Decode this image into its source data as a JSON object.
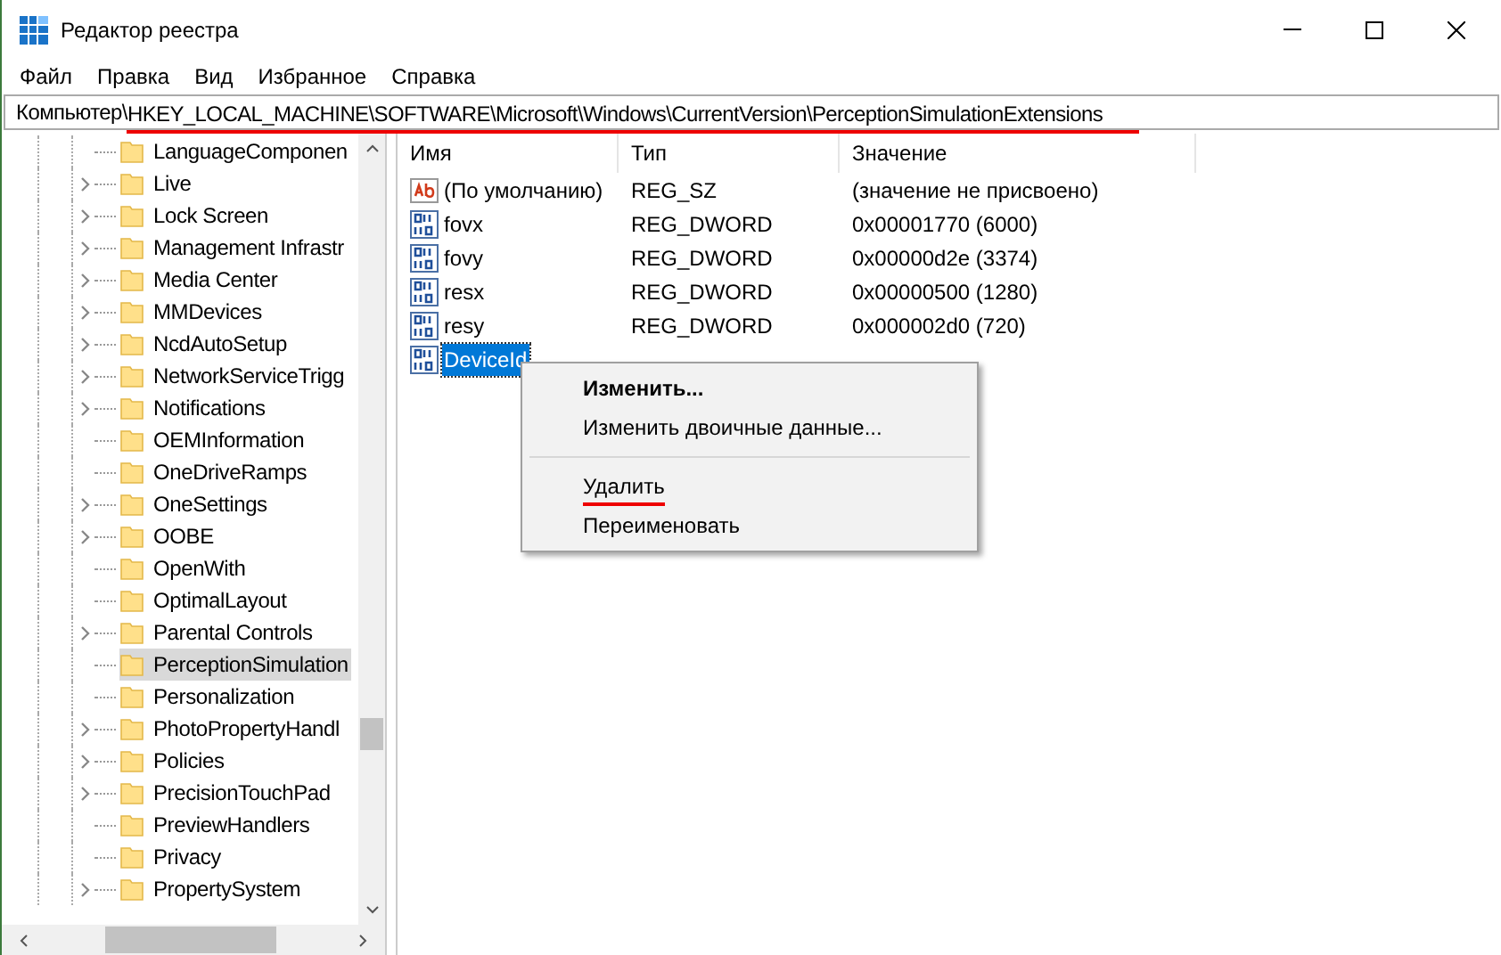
{
  "window": {
    "title": "Редактор реестра"
  },
  "menu_bar": [
    "Файл",
    "Правка",
    "Вид",
    "Избранное",
    "Справка"
  ],
  "address_bar": {
    "root": "Компьютер\\",
    "path": "HKEY_LOCAL_MACHINE\\SOFTWARE\\Microsoft\\Windows\\CurrentVersion\\PerceptionSimulationExtensions",
    "path_underlined": true
  },
  "tree": {
    "items": [
      {
        "label": "LanguageComponen",
        "expandable": false,
        "selected": false
      },
      {
        "label": "Live",
        "expandable": true,
        "selected": false
      },
      {
        "label": "Lock Screen",
        "expandable": true,
        "selected": false
      },
      {
        "label": "Management Infrastr",
        "expandable": true,
        "selected": false
      },
      {
        "label": "Media Center",
        "expandable": true,
        "selected": false
      },
      {
        "label": "MMDevices",
        "expandable": true,
        "selected": false
      },
      {
        "label": "NcdAutoSetup",
        "expandable": true,
        "selected": false
      },
      {
        "label": "NetworkServiceTrigg",
        "expandable": true,
        "selected": false
      },
      {
        "label": "Notifications",
        "expandable": true,
        "selected": false
      },
      {
        "label": "OEMInformation",
        "expandable": false,
        "selected": false
      },
      {
        "label": "OneDriveRamps",
        "expandable": false,
        "selected": false
      },
      {
        "label": "OneSettings",
        "expandable": true,
        "selected": false
      },
      {
        "label": "OOBE",
        "expandable": true,
        "selected": false
      },
      {
        "label": "OpenWith",
        "expandable": false,
        "selected": false
      },
      {
        "label": "OptimalLayout",
        "expandable": false,
        "selected": false
      },
      {
        "label": "Parental Controls",
        "expandable": true,
        "selected": false
      },
      {
        "label": "PerceptionSimulation",
        "expandable": false,
        "selected": true
      },
      {
        "label": "Personalization",
        "expandable": false,
        "selected": false
      },
      {
        "label": "PhotoPropertyHandl",
        "expandable": true,
        "selected": false
      },
      {
        "label": "Policies",
        "expandable": true,
        "selected": false
      },
      {
        "label": "PrecisionTouchPad",
        "expandable": true,
        "selected": false
      },
      {
        "label": "PreviewHandlers",
        "expandable": false,
        "selected": false
      },
      {
        "label": "Privacy",
        "expandable": false,
        "selected": false
      },
      {
        "label": "PropertySystem",
        "expandable": true,
        "selected": false
      }
    ]
  },
  "values_table": {
    "columns": [
      "Имя",
      "Тип",
      "Значение"
    ],
    "rows": [
      {
        "kind": "string",
        "name": "(По умолчанию)",
        "type": "REG_SZ",
        "data": "(значение не присвоено)",
        "selected": false
      },
      {
        "kind": "binary",
        "name": "fovx",
        "type": "REG_DWORD",
        "data": "0x00001770 (6000)",
        "selected": false
      },
      {
        "kind": "binary",
        "name": "fovy",
        "type": "REG_DWORD",
        "data": "0x00000d2e (3374)",
        "selected": false
      },
      {
        "kind": "binary",
        "name": "resx",
        "type": "REG_DWORD",
        "data": "0x00000500 (1280)",
        "selected": false
      },
      {
        "kind": "binary",
        "name": "resy",
        "type": "REG_DWORD",
        "data": "0x000002d0 (720)",
        "selected": false
      },
      {
        "kind": "binary",
        "name": "DeviceId",
        "selected": true
      }
    ]
  },
  "context_menu": {
    "items": [
      {
        "kind": "item",
        "label": "Изменить...",
        "bold": true,
        "underlined": false
      },
      {
        "kind": "item",
        "label": "Изменить двоичные данные...",
        "bold": false,
        "underlined": false
      },
      {
        "kind": "separator"
      },
      {
        "kind": "item",
        "label": "Удалить",
        "bold": false,
        "underlined": true
      },
      {
        "kind": "item",
        "label": "Переименовать",
        "bold": false,
        "underlined": false
      }
    ]
  }
}
